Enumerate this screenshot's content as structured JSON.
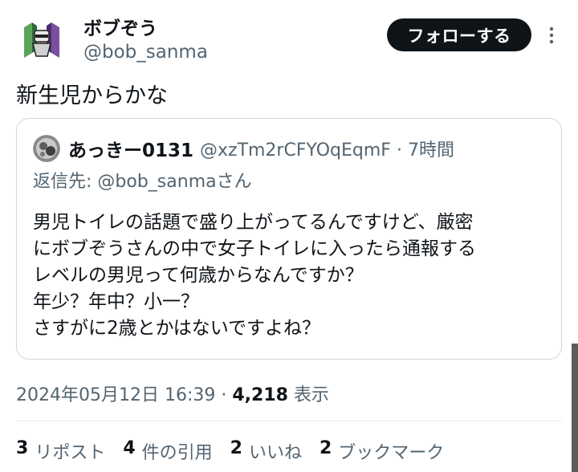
{
  "author": {
    "name": "ボブぞう",
    "handle": "@bob_sanma"
  },
  "follow_label": "フォローする",
  "tweet_text": "新生児からかな",
  "quote": {
    "name": "あっきー0131",
    "handle": "@xzTm2rCFYOqEqmF",
    "separator": "·",
    "time": "7時間",
    "reply_prefix": "返信先:",
    "reply_mention": "@bob_sanma",
    "reply_suffix": "さん",
    "body_lines": [
      "男児トイレの話題で盛り上がってるんですけど、厳密",
      "にボブぞうさんの中で女子トイレに入ったら通報する",
      "レベルの男児って何歳からなんですか？",
      "年少？年中？小一？",
      "さすがに2歳とかはないですよね？"
    ]
  },
  "timestamp": {
    "datetime": "2024年05月12日 16:39",
    "separator": "·",
    "views_count": "4,218",
    "views_label": "表示"
  },
  "stats": [
    {
      "count": "3",
      "label": "リポスト"
    },
    {
      "count": "4",
      "label": "件の引用"
    },
    {
      "count": "2",
      "label": "いいね"
    },
    {
      "count": "2",
      "label": "ブックマーク"
    }
  ],
  "icons": {
    "more": "more-vertical-icon",
    "avatar": "avatar-image"
  },
  "colors": {
    "text": "#0f1419",
    "secondary": "#536471",
    "border": "#cfd9de",
    "button_bg": "#0f1419"
  }
}
